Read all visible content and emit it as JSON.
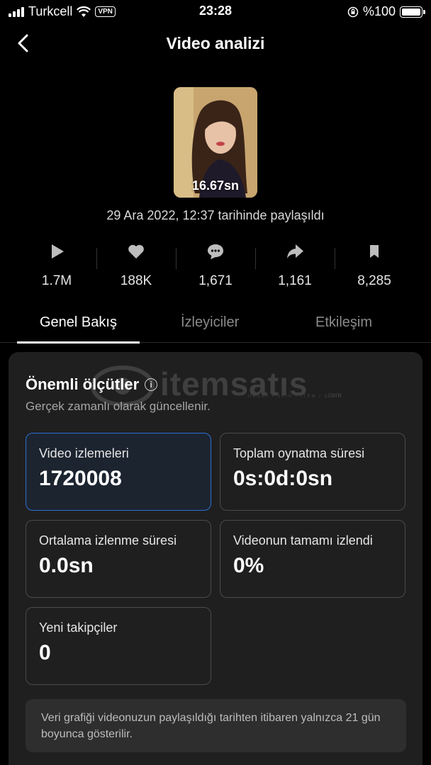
{
  "status_bar": {
    "carrier": "Turkcell",
    "vpn": "VPN",
    "time": "23:28",
    "battery": "%100"
  },
  "header": {
    "title": "Video analizi",
    "back_icon": "chevron-left-icon"
  },
  "video": {
    "duration": "16.67sn",
    "posted": "29 Ara 2022, 12:37 tarihinde paylaşıldı"
  },
  "stats": [
    {
      "icon": "play-icon",
      "value": "1.7M"
    },
    {
      "icon": "heart-icon",
      "value": "188K"
    },
    {
      "icon": "comment-icon",
      "value": "1,671"
    },
    {
      "icon": "share-icon",
      "value": "1,161"
    },
    {
      "icon": "bookmark-icon",
      "value": "8,285"
    }
  ],
  "tabs": [
    {
      "label": "Genel Bakış",
      "active": true
    },
    {
      "label": "İzleyiciler",
      "active": false
    },
    {
      "label": "Etkileşim",
      "active": false
    }
  ],
  "watermark": {
    "brand": "itemsatıs",
    "tagline": "HESAP / SKIN / ITEM / E-PIN",
    "domain": ".com"
  },
  "metrics_section": {
    "title": "Önemli ölçütler",
    "info_icon": "info-icon",
    "info_glyph": "i",
    "subtitle": "Gerçek zamanlı olarak güncellenir.",
    "cards": [
      {
        "label": "Video izlemeleri",
        "value": "1720008",
        "selected": true
      },
      {
        "label": "Toplam oynatma süresi",
        "value": "0s:0d:0sn"
      },
      {
        "label": "Ortalama izlenme süresi",
        "value": "0.0sn"
      },
      {
        "label": "Videonun tamamı izlendi",
        "value": "0%"
      },
      {
        "label": "Yeni takipçiler",
        "value": "0"
      }
    ]
  },
  "note": "Veri grafiği videonuzun paylaşıldığı tarihten itibaren yalnızca 21 gün boyunca gösterilir.",
  "colors": {
    "background": "#000000",
    "card": "#1f1f1f",
    "selected_border": "#2c6fd6",
    "muted_text": "#8a8a8a"
  }
}
